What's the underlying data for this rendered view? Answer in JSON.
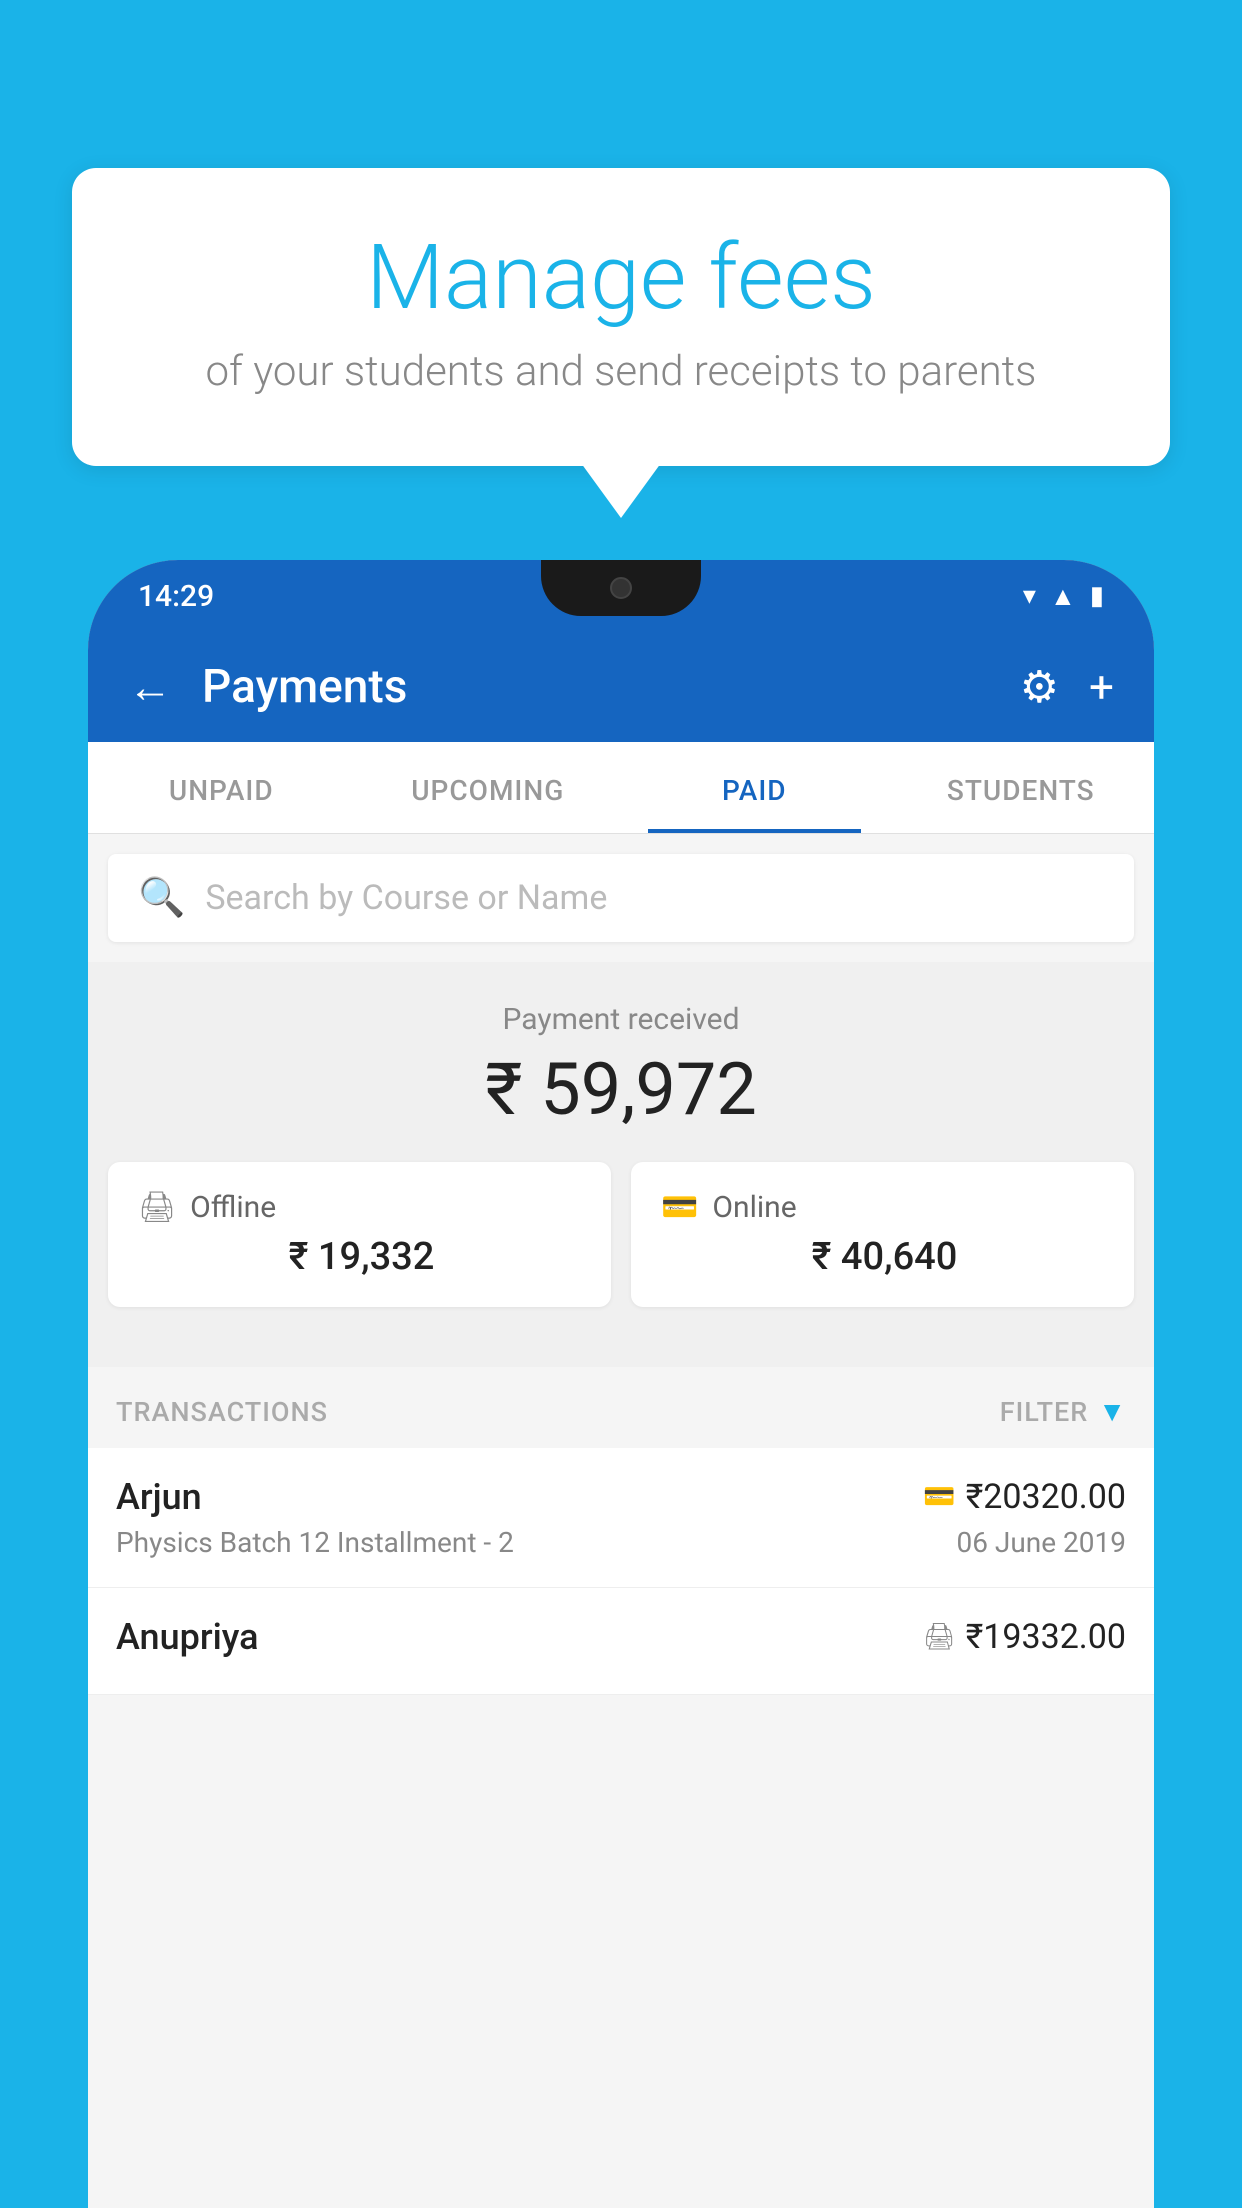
{
  "background_color": "#1ab3e8",
  "bubble": {
    "title": "Manage fees",
    "subtitle": "of your students and send receipts to parents"
  },
  "phone": {
    "status_bar": {
      "time": "14:29"
    },
    "app_bar": {
      "title": "Payments",
      "back_label": "←",
      "settings_label": "⚙",
      "add_label": "+"
    },
    "tabs": [
      {
        "label": "UNPAID",
        "active": false
      },
      {
        "label": "UPCOMING",
        "active": false
      },
      {
        "label": "PAID",
        "active": true
      },
      {
        "label": "STUDENTS",
        "active": false
      }
    ],
    "search": {
      "placeholder": "Search by Course or Name"
    },
    "payment_received": {
      "label": "Payment received",
      "amount": "₹ 59,972"
    },
    "payment_cards": [
      {
        "icon": "💳",
        "label": "Offline",
        "amount": "₹ 19,332"
      },
      {
        "icon": "💳",
        "label": "Online",
        "amount": "₹ 40,640"
      }
    ],
    "transactions_header": {
      "label": "TRANSACTIONS",
      "filter_label": "FILTER"
    },
    "transactions": [
      {
        "name": "Arjun",
        "type_icon": "💳",
        "amount": "₹20320.00",
        "course": "Physics Batch 12 Installment - 2",
        "date": "06 June 2019"
      },
      {
        "name": "Anupriya",
        "type_icon": "💵",
        "amount": "₹19332.00",
        "course": "",
        "date": ""
      }
    ]
  }
}
